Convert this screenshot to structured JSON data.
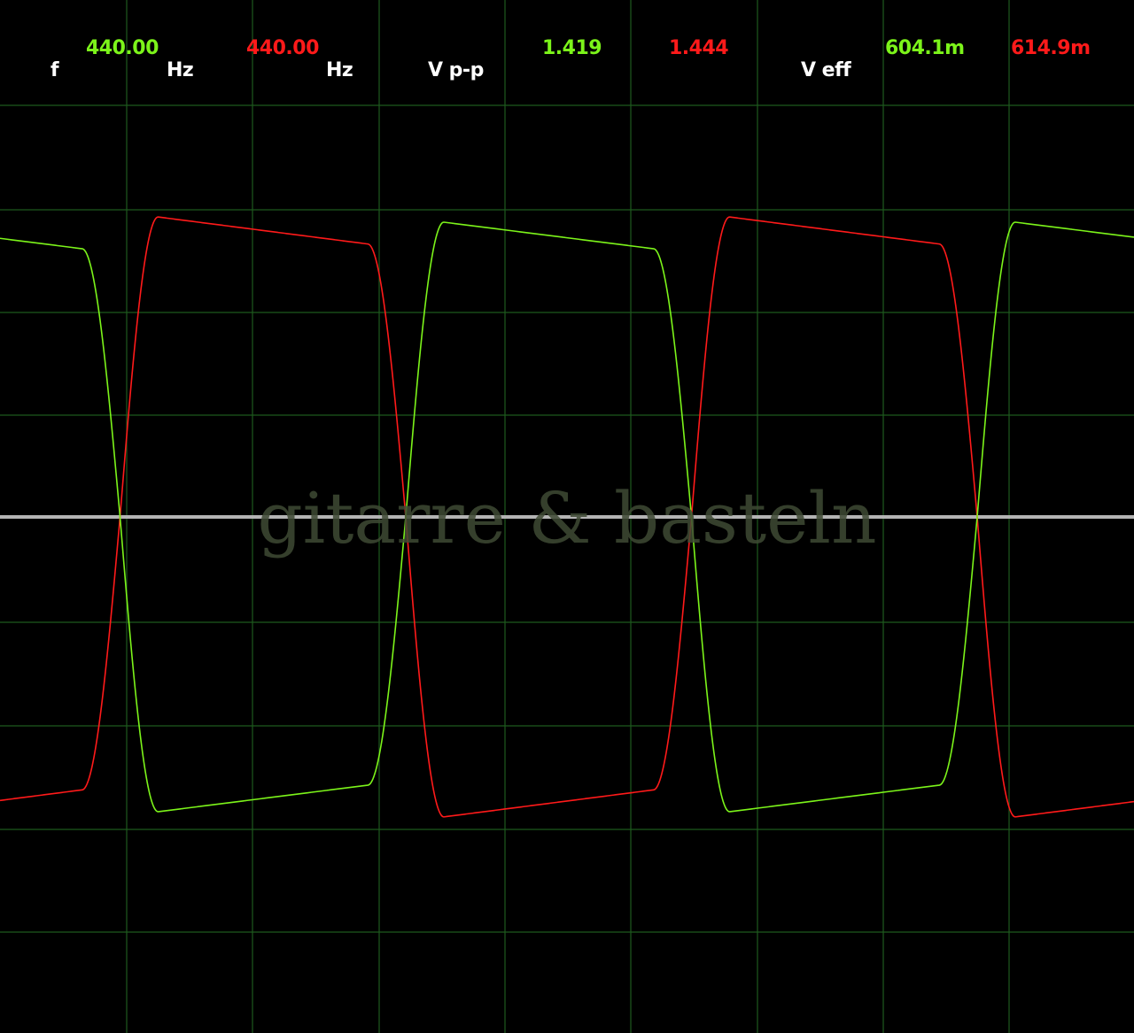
{
  "readouts": {
    "f_label": "f",
    "f_ch1": "440.00",
    "f_unit_1": "Hz",
    "f_ch2": "440.00",
    "f_unit_2": "Hz",
    "vpp_label": "V p-p",
    "vpp_ch1": "1.419",
    "vpp_ch2": "1.444",
    "veff_label": "V eff",
    "veff_ch1": "604.1m",
    "veff_ch2": "614.9m"
  },
  "watermark": "gitarre & basteln",
  "colors": {
    "background": "#000000",
    "grid": "#1e5a1e",
    "baseline": "#b4b4b4",
    "ch1": "#7cf41a",
    "ch2": "#ff1a1a",
    "label": "#ffffff"
  },
  "traces": {
    "frequency_hz": 440.0,
    "ch1_vpp": 1.419,
    "ch2_vpp": 1.444,
    "ch2_phase_deg": 180
  }
}
